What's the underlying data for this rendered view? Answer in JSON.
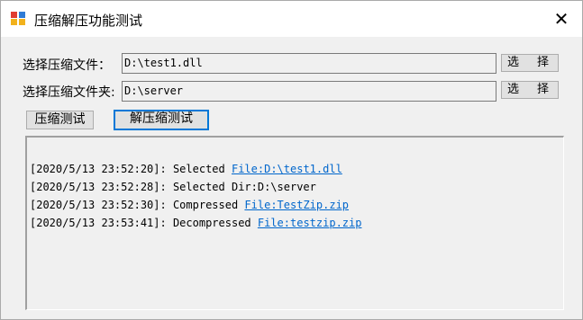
{
  "window": {
    "title": "压缩解压功能测试",
    "close_glyph": "✕"
  },
  "form": {
    "file_label": "选择压缩文件：",
    "file_value": "D:\\test1.dll",
    "dir_label": "选择压缩文件夹:",
    "dir_value": "D:\\server",
    "browse_label_left": "选",
    "browse_label_right": "择"
  },
  "buttons": {
    "compress": "压缩测试",
    "decompress": "解压缩测试"
  },
  "log": [
    {
      "prefix": "[2020/5/13 23:52:20]: Selected ",
      "link": "File:D:\\test1.dll"
    },
    {
      "prefix": "[2020/5/13 23:52:28]: Selected Dir:D:\\server",
      "link": ""
    },
    {
      "prefix": "[2020/5/13 23:52:30]: Compressed ",
      "link": "File:TestZip.zip"
    },
    {
      "prefix": "[2020/5/13 23:53:41]: Decompressed ",
      "link": "File:testzip.zip"
    }
  ],
  "colors": {
    "link": "#0066cc",
    "focus_border": "#0078d7",
    "window_bg": "#f0f0f0"
  },
  "icons": {
    "app": "app-window-icon",
    "close": "close-icon"
  }
}
